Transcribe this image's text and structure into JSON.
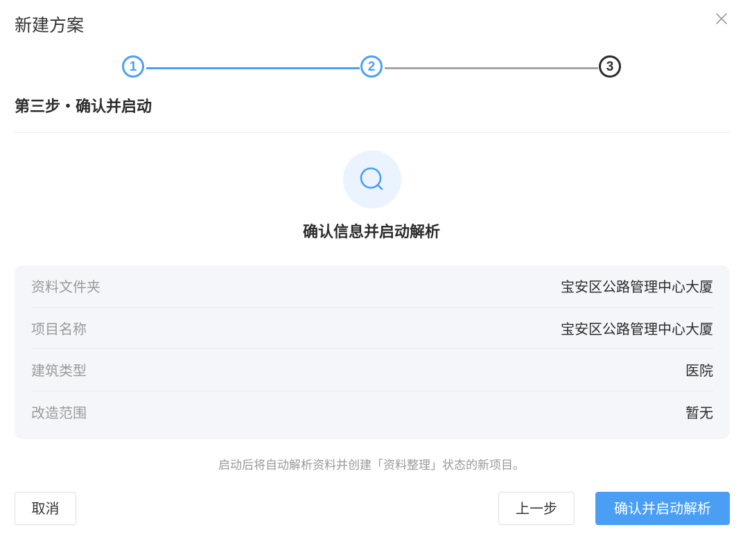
{
  "dialog": {
    "title": "新建方案",
    "close_icon": "close-icon"
  },
  "stepper": {
    "steps": [
      {
        "label": "1",
        "state": "done"
      },
      {
        "label": "2",
        "state": "done"
      },
      {
        "label": "3",
        "state": "current"
      }
    ],
    "heading": "第三步・确认并启动"
  },
  "hero": {
    "icon": "search-icon",
    "title": "确认信息并启动解析"
  },
  "info": {
    "rows": [
      {
        "key": "资料文件夹",
        "value": "宝安区公路管理中心大厦"
      },
      {
        "key": "项目名称",
        "value": "宝安区公路管理中心大厦"
      },
      {
        "key": "建筑类型",
        "value": "医院"
      },
      {
        "key": "改造范围",
        "value": "暂无"
      }
    ]
  },
  "hint": "启动后将自动解析资料并创建「资料整理」状态的新项目。",
  "buttons": {
    "cancel": "取消",
    "prev": "上一步",
    "confirm": "确认并启动解析"
  },
  "colors": {
    "accent": "#4a9ff5",
    "hero_bg": "#eaf3fe",
    "card_bg": "#f4f6fa"
  }
}
